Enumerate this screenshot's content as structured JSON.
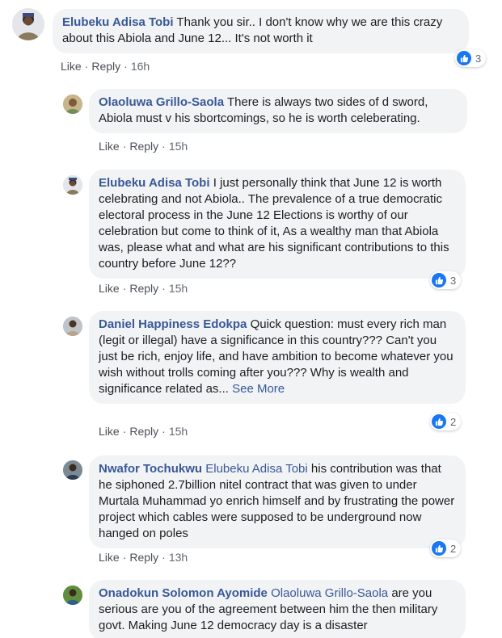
{
  "reaction_color": "#1877f2",
  "link_color": "#385898",
  "comments": [
    {
      "author": "Elubeku Adisa Tobi",
      "mention": "",
      "text": "Thank you sir.. I don't know why we are this crazy about this Abiola and June 12... It's not worth it",
      "see_more": "",
      "like": "Like",
      "reply": "Reply",
      "time": "16h",
      "reactions": "3",
      "reaction_icon": "like-thumb-icon"
    },
    {
      "author": "Olaoluwa Grillo-Saola",
      "mention": "",
      "text": "There is always two sides of d sword, Abiola must v his sbortcomings, so he is worth celeberating.",
      "see_more": "",
      "like": "Like",
      "reply": "Reply",
      "time": "15h",
      "reactions": "",
      "reaction_icon": ""
    },
    {
      "author": "Elubeku Adisa Tobi",
      "mention": "",
      "text": "I just personally think that June 12 is worth celebrating and not Abiola.. The prevalence of a true democratic electoral process in the June 12 Elections is worthy of our celebration but come to think of it, As a wealthy man that Abiola was, please what and what are his significant contributions to this country before June 12??",
      "see_more": "",
      "like": "Like",
      "reply": "Reply",
      "time": "15h",
      "reactions": "3",
      "reaction_icon": "like-thumb-icon"
    },
    {
      "author": "Daniel Happiness Edokpa",
      "mention": "",
      "text": "Quick question: must every rich man (legit or illegal) have a significance in this country??? Can't you just be rich, enjoy life, and have ambition to become whatever you wish without trolls coming after you??? Why is wealth and significance related as...",
      "see_more": "See More",
      "like": "Like",
      "reply": "Reply",
      "time": "15h",
      "reactions": "2",
      "reaction_icon": "like-thumb-icon"
    },
    {
      "author": "Nwafor Tochukwu",
      "mention": "Elubeku Adisa Tobi",
      "text": "his contribution was that he siphoned 2.7billion nitel contract that was given to under Murtala Muhammad yo enrich himself and by frustrating the power project which cables were supposed to be underground now hanged on poles",
      "see_more": "",
      "like": "Like",
      "reply": "Reply",
      "time": "13h",
      "reactions": "2",
      "reaction_icon": "like-thumb-icon"
    },
    {
      "author": "Onadokun Solomon Ayomide",
      "mention": "Olaoluwa Grillo-Saola",
      "text": "are you serious are you of the agreement between him the then military govt. Making June 12 democracy day is a disaster",
      "see_more": "",
      "like": "",
      "reply": "",
      "time": "",
      "reactions": "",
      "reaction_icon": ""
    }
  ]
}
